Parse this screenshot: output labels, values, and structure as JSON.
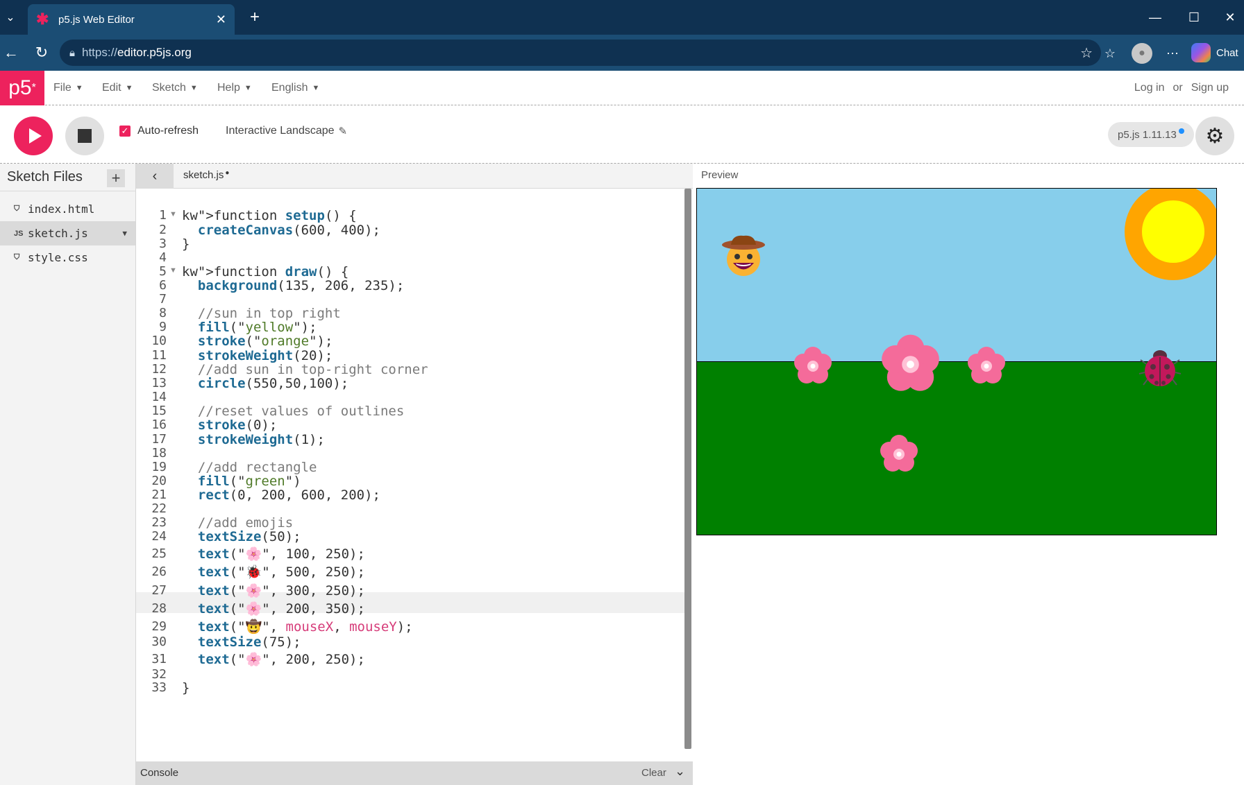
{
  "browser": {
    "tab_title": "p5.js Web Editor",
    "url_scheme": "https://",
    "url_host": "editor.p5js.org",
    "chat_label": "Chat"
  },
  "menu": {
    "logo": "p5",
    "items": [
      "File",
      "Edit",
      "Sketch",
      "Help",
      "English"
    ],
    "login": "Log in",
    "or": "or",
    "signup": "Sign up"
  },
  "toolbar": {
    "auto_refresh": "Auto-refresh",
    "sketch_name": "Interactive Landscape",
    "version": "p5.js 1.11.13"
  },
  "sidebar": {
    "title": "Sketch Files",
    "files": [
      {
        "icon": "HTML",
        "name": "index.html"
      },
      {
        "icon": "JS",
        "name": "sketch.js"
      },
      {
        "icon": "CSS",
        "name": "style.css"
      }
    ]
  },
  "editor": {
    "file_tab": "sketch.js",
    "line_numbers": [
      "1",
      "2",
      "3",
      "4",
      "5",
      "6",
      "7",
      "8",
      "9",
      "10",
      "11",
      "12",
      "13",
      "14",
      "15",
      "16",
      "17",
      "18",
      "19",
      "20",
      "21",
      "22",
      "23",
      "24",
      "25",
      "26",
      "27",
      "28",
      "29",
      "30",
      "31",
      "32",
      "33"
    ],
    "code_lines": [
      "function setup() {",
      "  createCanvas(600, 400);",
      "}",
      "",
      "function draw() {",
      "  background(135, 206, 235);",
      "",
      "  //sun in top right",
      "  fill(\"yellow\");",
      "  stroke(\"orange\");",
      "  strokeWeight(20);",
      "  //add sun in top-right corner",
      "  circle(550,50,100);",
      "",
      "  //reset values of outlines",
      "  stroke(0);",
      "  strokeWeight(1);",
      "",
      "  //add rectangle",
      "  fill(\"green\")",
      "  rect(0, 200, 600, 200);",
      "",
      "  //add emojis",
      "  textSize(50);",
      "  text(\"🌸\", 100, 250);",
      "  text(\"🐞\", 500, 250);",
      "  text(\"🌸\", 300, 250);",
      "  text(\"🌸\", 200, 350);",
      "  text(\"🤠\", mouseX, mouseY);",
      "  textSize(75);",
      "  text(\"🌸\", 200, 250);",
      "",
      "}"
    ]
  },
  "console": {
    "label": "Console",
    "clear": "Clear"
  },
  "preview": {
    "label": "Preview"
  },
  "colors": {
    "brand": "#ed225d",
    "sky": "#87ceeb",
    "ground": "#008000",
    "sun_fill": "#ffff00",
    "sun_stroke": "#ffa500"
  }
}
